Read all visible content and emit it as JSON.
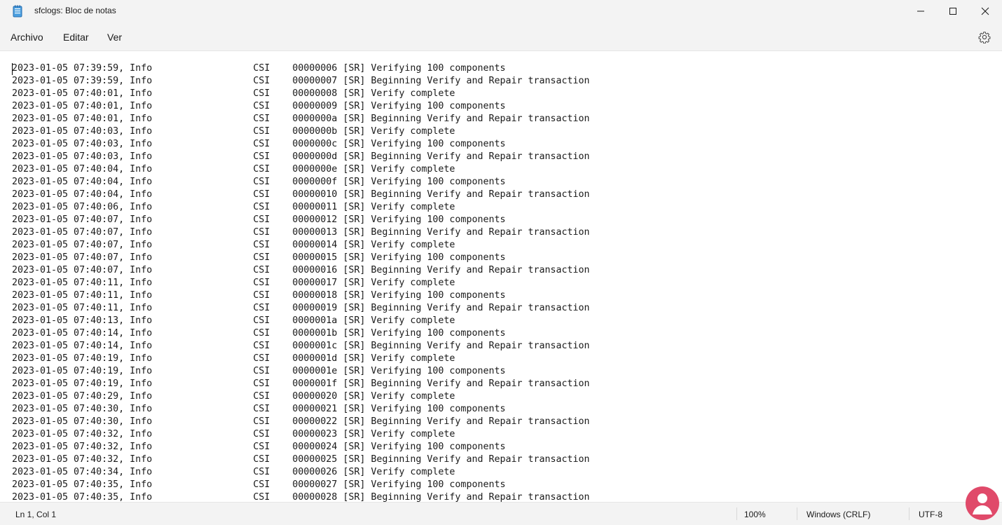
{
  "window": {
    "title": "sfclogs: Bloc de notas"
  },
  "menu": {
    "items": [
      "Archivo",
      "Editar",
      "Ver"
    ],
    "settings_icon": "gear-icon"
  },
  "editor": {
    "lines": [
      "2023-01-05 07:39:59, Info                  CSI    00000006 [SR] Verifying 100 components",
      "2023-01-05 07:39:59, Info                  CSI    00000007 [SR] Beginning Verify and Repair transaction",
      "2023-01-05 07:40:01, Info                  CSI    00000008 [SR] Verify complete",
      "2023-01-05 07:40:01, Info                  CSI    00000009 [SR] Verifying 100 components",
      "2023-01-05 07:40:01, Info                  CSI    0000000a [SR] Beginning Verify and Repair transaction",
      "2023-01-05 07:40:03, Info                  CSI    0000000b [SR] Verify complete",
      "2023-01-05 07:40:03, Info                  CSI    0000000c [SR] Verifying 100 components",
      "2023-01-05 07:40:03, Info                  CSI    0000000d [SR] Beginning Verify and Repair transaction",
      "2023-01-05 07:40:04, Info                  CSI    0000000e [SR] Verify complete",
      "2023-01-05 07:40:04, Info                  CSI    0000000f [SR] Verifying 100 components",
      "2023-01-05 07:40:04, Info                  CSI    00000010 [SR] Beginning Verify and Repair transaction",
      "2023-01-05 07:40:06, Info                  CSI    00000011 [SR] Verify complete",
      "2023-01-05 07:40:07, Info                  CSI    00000012 [SR] Verifying 100 components",
      "2023-01-05 07:40:07, Info                  CSI    00000013 [SR] Beginning Verify and Repair transaction",
      "2023-01-05 07:40:07, Info                  CSI    00000014 [SR] Verify complete",
      "2023-01-05 07:40:07, Info                  CSI    00000015 [SR] Verifying 100 components",
      "2023-01-05 07:40:07, Info                  CSI    00000016 [SR] Beginning Verify and Repair transaction",
      "2023-01-05 07:40:11, Info                  CSI    00000017 [SR] Verify complete",
      "2023-01-05 07:40:11, Info                  CSI    00000018 [SR] Verifying 100 components",
      "2023-01-05 07:40:11, Info                  CSI    00000019 [SR] Beginning Verify and Repair transaction",
      "2023-01-05 07:40:13, Info                  CSI    0000001a [SR] Verify complete",
      "2023-01-05 07:40:14, Info                  CSI    0000001b [SR] Verifying 100 components",
      "2023-01-05 07:40:14, Info                  CSI    0000001c [SR] Beginning Verify and Repair transaction",
      "2023-01-05 07:40:19, Info                  CSI    0000001d [SR] Verify complete",
      "2023-01-05 07:40:19, Info                  CSI    0000001e [SR] Verifying 100 components",
      "2023-01-05 07:40:19, Info                  CSI    0000001f [SR] Beginning Verify and Repair transaction",
      "2023-01-05 07:40:29, Info                  CSI    00000020 [SR] Verify complete",
      "2023-01-05 07:40:30, Info                  CSI    00000021 [SR] Verifying 100 components",
      "2023-01-05 07:40:30, Info                  CSI    00000022 [SR] Beginning Verify and Repair transaction",
      "2023-01-05 07:40:32, Info                  CSI    00000023 [SR] Verify complete",
      "2023-01-05 07:40:32, Info                  CSI    00000024 [SR] Verifying 100 components",
      "2023-01-05 07:40:32, Info                  CSI    00000025 [SR] Beginning Verify and Repair transaction",
      "2023-01-05 07:40:34, Info                  CSI    00000026 [SR] Verify complete",
      "2023-01-05 07:40:35, Info                  CSI    00000027 [SR] Verifying 100 components",
      "2023-01-05 07:40:35, Info                  CSI    00000028 [SR] Beginning Verify and Repair transaction"
    ]
  },
  "status": {
    "position": "Ln 1, Col 1",
    "zoom": "100%",
    "line_ending": "Windows (CRLF)",
    "encoding": "UTF-8"
  },
  "colors": {
    "chrome_bg": "#f3f3f3",
    "editor_bg": "#ffffff",
    "watermark": "#e04a6a"
  }
}
